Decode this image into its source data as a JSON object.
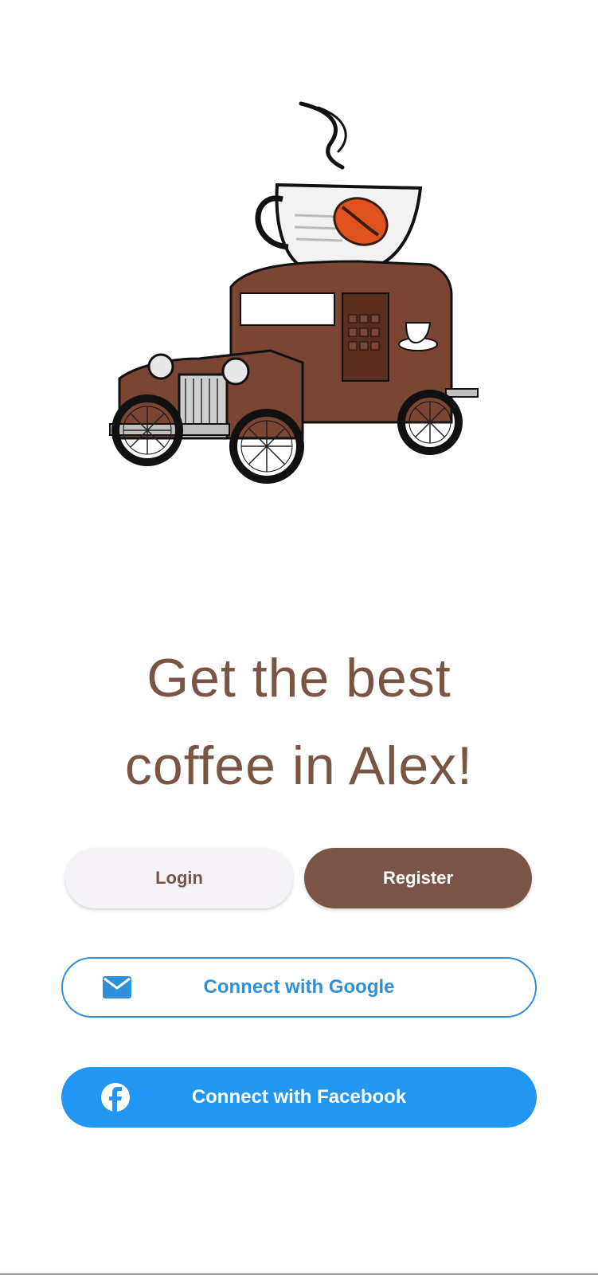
{
  "welcome": {
    "headline_line1": "Get the best",
    "headline_line2": "coffee in Alex!"
  },
  "auth": {
    "login_label": "Login",
    "register_label": "Register"
  },
  "social": {
    "google_label": "Connect with Google",
    "google_icon": "mail-icon",
    "facebook_label": "Connect with Facebook",
    "facebook_icon": "facebook-icon"
  },
  "colors": {
    "brown": "#7a5546",
    "google_blue": "#2f8fd8",
    "facebook_blue": "#2196f3",
    "login_bg": "#f6f3f8"
  }
}
